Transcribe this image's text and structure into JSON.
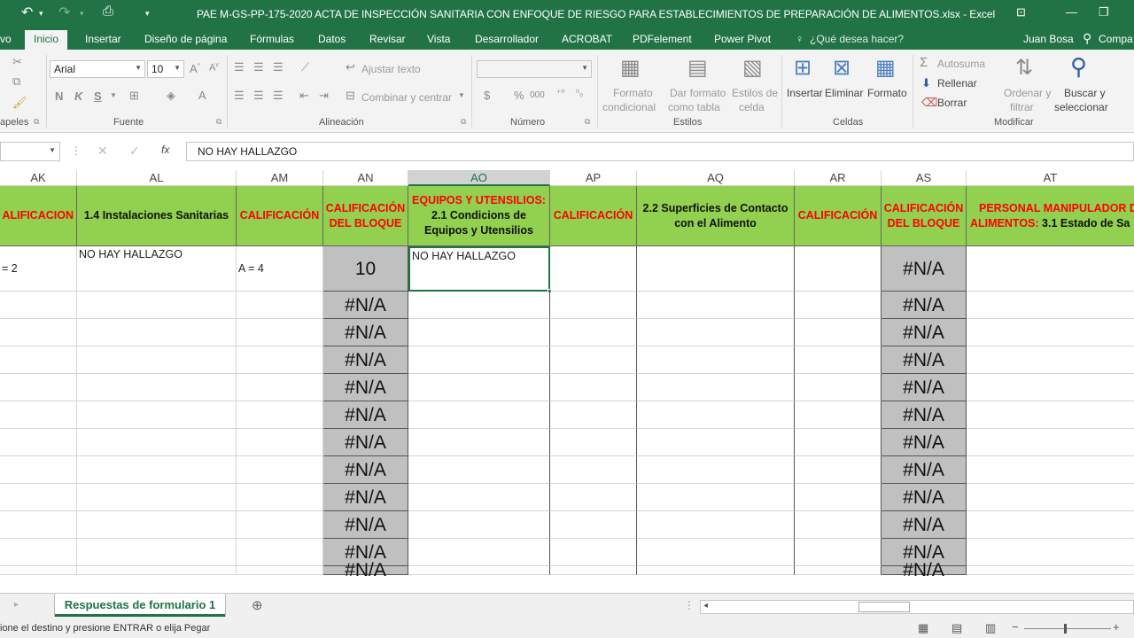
{
  "title": "PAE M-GS-PP-175-2020 ACTA DE INSPECCIÓN SANITARIA CON ENFOQUE DE RIESGO PARA ESTABLECIMIENTOS DE PREPARACIÓN DE ALIMENTOS.xlsx - Excel",
  "tabs": [
    "vo",
    "Inicio",
    "Insertar",
    "Diseño de página",
    "Fórmulas",
    "Datos",
    "Revisar",
    "Vista",
    "Desarrollador",
    "ACROBAT",
    "PDFelement",
    "Power Pivot"
  ],
  "tell_me": "¿Qué desea hacer?",
  "user": "Juan Bosa",
  "share": "Compa",
  "ribbon": {
    "font_name": "Arial",
    "font_size": "10",
    "wrap_text": "Ajustar texto",
    "merge_center": "Combinar y centrar",
    "cond_format_1": "Formato",
    "cond_format_2": "condicional",
    "table_format_1": "Dar formato",
    "table_format_2": "como tabla",
    "cell_styles_1": "Estilos de",
    "cell_styles_2": "celda",
    "insert": "Insertar",
    "delete": "Eliminar",
    "format": "Formato",
    "autosum": "Autosuma",
    "fill": "Rellenar",
    "clear": "Borrar",
    "sort_1": "Ordenar y",
    "sort_2": "filtrar",
    "find_1": "Buscar y",
    "find_2": "seleccionar",
    "groups": {
      "clipboard": "apeles",
      "font": "Fuente",
      "alignment": "Alineación",
      "number": "Número",
      "styles": "Estilos",
      "cells": "Celdas",
      "editing": "Modificar"
    },
    "font_buttons": [
      "N",
      "K",
      "S"
    ]
  },
  "formula_bar": {
    "fx": "fx",
    "content": "NO HAY HALLAZGO"
  },
  "columns": [
    "AK",
    "AL",
    "AM",
    "AN",
    "AO",
    "AP",
    "AQ",
    "AR",
    "AS",
    "AT"
  ],
  "headers": {
    "ak": "ALIFICACION",
    "al": "1.4 Instalaciones Sanitarias",
    "am": "CALIFICACIÓN",
    "an_1": "CALIFICACIÓN",
    "an_2": "DEL BLOQUE",
    "ao_red": "EQUIPOS Y UTENSILIOS:",
    "ao_black": "2.1 Condicions de Equipos y Utensilios",
    "ap": "CALIFICACIÓN",
    "aq": "2.2 Superficies de Contacto con el Alimento",
    "ar": "CALIFICACIÓN",
    "as_1": "CALIFICACIÓN",
    "as_2": "DEL BLOQUE",
    "at_red_1": "PERSONAL MANIPULADOR D",
    "at_red_2": "ALIMENTOS:",
    "at_black": " 3.1 Estado de Sa"
  },
  "row1": {
    "ak": "= 2",
    "al": "NO HAY HALLAZGO",
    "am": "A = 4",
    "an": "10",
    "ao": "NO HAY HALLAZGO",
    "as": "#N/A"
  },
  "na_value": "#N/A",
  "sheet_tab": "Respuestas de formulario 1",
  "status": "ione el destino y presione ENTRAR o elija Pegar"
}
